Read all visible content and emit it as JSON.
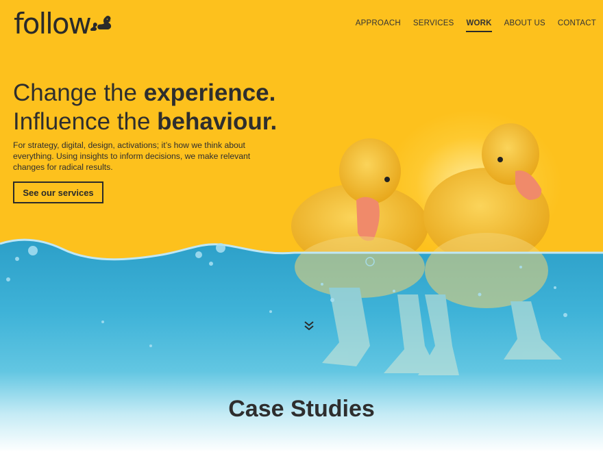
{
  "brand": {
    "logo_text": "follow",
    "logo_mark": "duck-family-icon"
  },
  "nav": {
    "items": [
      {
        "label": "APPROACH",
        "active": false
      },
      {
        "label": "SERVICES",
        "active": false
      },
      {
        "label": "WORK",
        "active": true
      },
      {
        "label": "ABOUT US",
        "active": false
      },
      {
        "label": "CONTACT",
        "active": false
      }
    ]
  },
  "hero": {
    "line1_prefix": "Change the ",
    "line1_bold": "experience.",
    "line2_prefix": "Influence the ",
    "line2_bold": "behaviour.",
    "intro": "For strategy, digital, design, activations; it’s how we think about everything. Using insights to inform decisions, we make relevant changes for radical results.",
    "cta_label": "See our services",
    "scroll_icon": "double-chevron-down-icon"
  },
  "case_studies": {
    "title": "Case Studies"
  },
  "colors": {
    "background": "#fdc11d",
    "text": "#2e2e2e",
    "water_top": "#3aa8cf",
    "water_bottom": "#ffffff",
    "duckling": "#f6c233",
    "beak": "#f08a6a"
  }
}
